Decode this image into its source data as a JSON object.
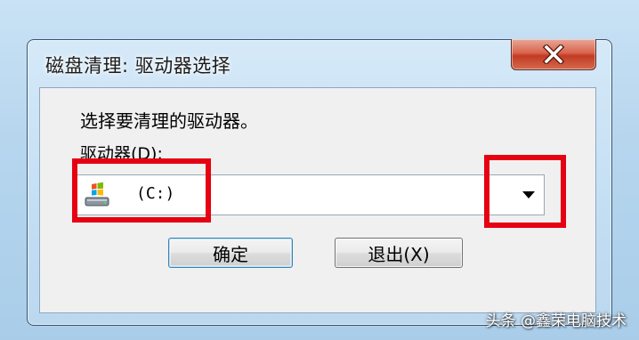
{
  "window": {
    "title": "磁盘清理: 驱动器选择",
    "close_icon": "close-icon"
  },
  "dialog": {
    "prompt": "选择要清理的驱动器。",
    "drive_label": "驱动器(D):",
    "drive_select": {
      "selected_value": "(C:)",
      "icon": "windows-drive-icon"
    }
  },
  "buttons": {
    "ok_label": "确定",
    "exit_label": "退出(X)"
  },
  "annotations": {
    "highlight_color": "#e60012"
  },
  "watermark": "头条 @鑫荣电脑技术"
}
